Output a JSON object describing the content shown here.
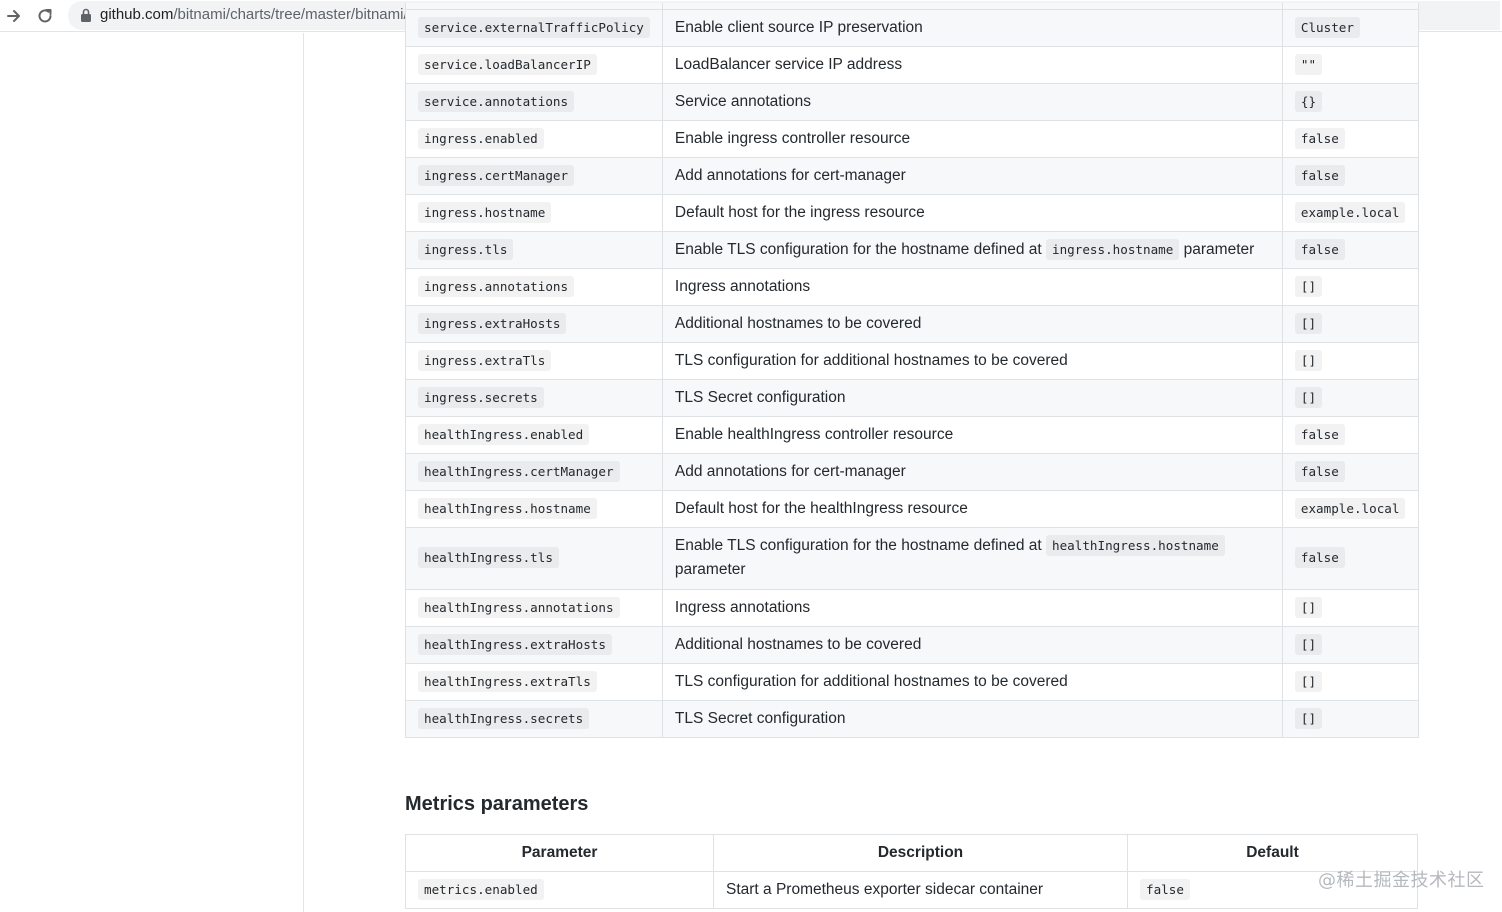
{
  "browser": {
    "url_host": "github.com",
    "url_path": "/bitnami/charts/tree/master/bitnami/nginx"
  },
  "main_table": {
    "rows": [
      {
        "param": "service.externalTrafficPolicy",
        "desc": "Enable client source IP preservation",
        "default": "Cluster"
      },
      {
        "param": "service.loadBalancerIP",
        "desc": "LoadBalancer service IP address",
        "default": "\"\""
      },
      {
        "param": "service.annotations",
        "desc": "Service annotations",
        "default": "{}"
      },
      {
        "param": "ingress.enabled",
        "desc": "Enable ingress controller resource",
        "default": "false"
      },
      {
        "param": "ingress.certManager",
        "desc": "Add annotations for cert-manager",
        "default": "false"
      },
      {
        "param": "ingress.hostname",
        "desc": "Default host for the ingress resource",
        "default": "example.local"
      },
      {
        "param": "ingress.tls",
        "desc_pre": "Enable TLS configuration for the hostname defined at",
        "desc_code": "ingress.hostname",
        "desc_post": "parameter",
        "default": "false"
      },
      {
        "param": "ingress.annotations",
        "desc": "Ingress annotations",
        "default": "[]"
      },
      {
        "param": "ingress.extraHosts",
        "desc": "Additional hostnames to be covered",
        "default": "[]"
      },
      {
        "param": "ingress.extraTls",
        "desc": "TLS configuration for additional hostnames to be covered",
        "default": "[]"
      },
      {
        "param": "ingress.secrets",
        "desc": "TLS Secret configuration",
        "default": "[]"
      },
      {
        "param": "healthIngress.enabled",
        "desc": "Enable healthIngress controller resource",
        "default": "false"
      },
      {
        "param": "healthIngress.certManager",
        "desc": "Add annotations for cert-manager",
        "default": "false"
      },
      {
        "param": "healthIngress.hostname",
        "desc": "Default host for the healthIngress resource",
        "default": "example.local"
      },
      {
        "param": "healthIngress.tls",
        "desc_pre": "Enable TLS configuration for the hostname defined at",
        "desc_code": "healthIngress.hostname",
        "desc_post": "parameter",
        "default": "false"
      },
      {
        "param": "healthIngress.annotations",
        "desc": "Ingress annotations",
        "default": "[]"
      },
      {
        "param": "healthIngress.extraHosts",
        "desc": "Additional hostnames to be covered",
        "default": "[]"
      },
      {
        "param": "healthIngress.extraTls",
        "desc": "TLS configuration for additional hostnames to be covered",
        "default": "[]"
      },
      {
        "param": "healthIngress.secrets",
        "desc": "TLS Secret configuration",
        "default": "[]"
      }
    ]
  },
  "metrics": {
    "heading": "Metrics parameters",
    "headers": {
      "param": "Parameter",
      "desc": "Description",
      "default": "Default"
    },
    "rows": [
      {
        "param": "metrics.enabled",
        "desc": "Start a Prometheus exporter sidecar container",
        "default": "false"
      }
    ]
  },
  "watermark": "@稀土掘金技术社区",
  "icons": {
    "back": "arrow-right-icon",
    "reload": "reload-icon",
    "secure": "lock-icon"
  }
}
